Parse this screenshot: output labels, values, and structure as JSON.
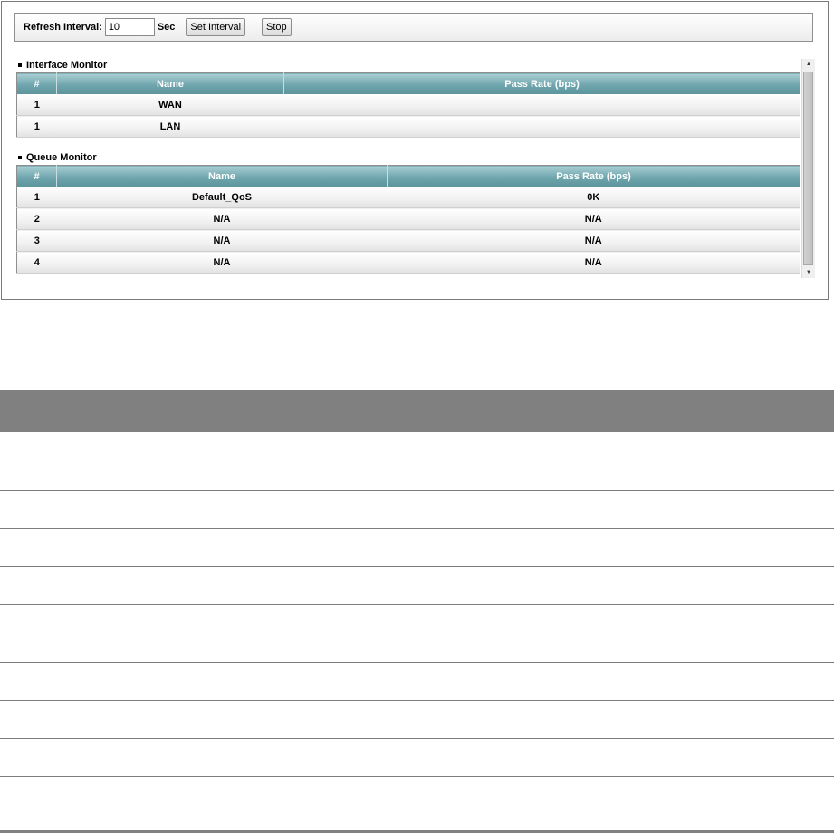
{
  "toolbar": {
    "refresh_label": "Refresh Interval:",
    "refresh_value": "10",
    "unit_label": "Sec",
    "set_interval_label": "Set Interval",
    "stop_label": "Stop"
  },
  "interface_monitor": {
    "title": "Interface Monitor",
    "columns": [
      "#",
      "Name",
      "Pass Rate (bps)"
    ],
    "rows": [
      {
        "num": "1",
        "name": "WAN",
        "rate": ""
      },
      {
        "num": "1",
        "name": "LAN",
        "rate": ""
      }
    ]
  },
  "queue_monitor": {
    "title": "Queue Monitor",
    "columns": [
      "#",
      "Name",
      "Pass Rate (bps)"
    ],
    "rows": [
      {
        "num": "1",
        "name": "Default_QoS",
        "rate": "0K"
      },
      {
        "num": "2",
        "name": "N/A",
        "rate": "N/A"
      },
      {
        "num": "3",
        "name": "N/A",
        "rate": "N/A"
      },
      {
        "num": "4",
        "name": "N/A",
        "rate": "N/A"
      }
    ]
  },
  "scrollbar": {
    "up_icon": "triangle-up",
    "down_icon": "triangle-down"
  },
  "colors": {
    "header_teal": "#6fa5ad",
    "doc_header_gray": "#808080"
  }
}
